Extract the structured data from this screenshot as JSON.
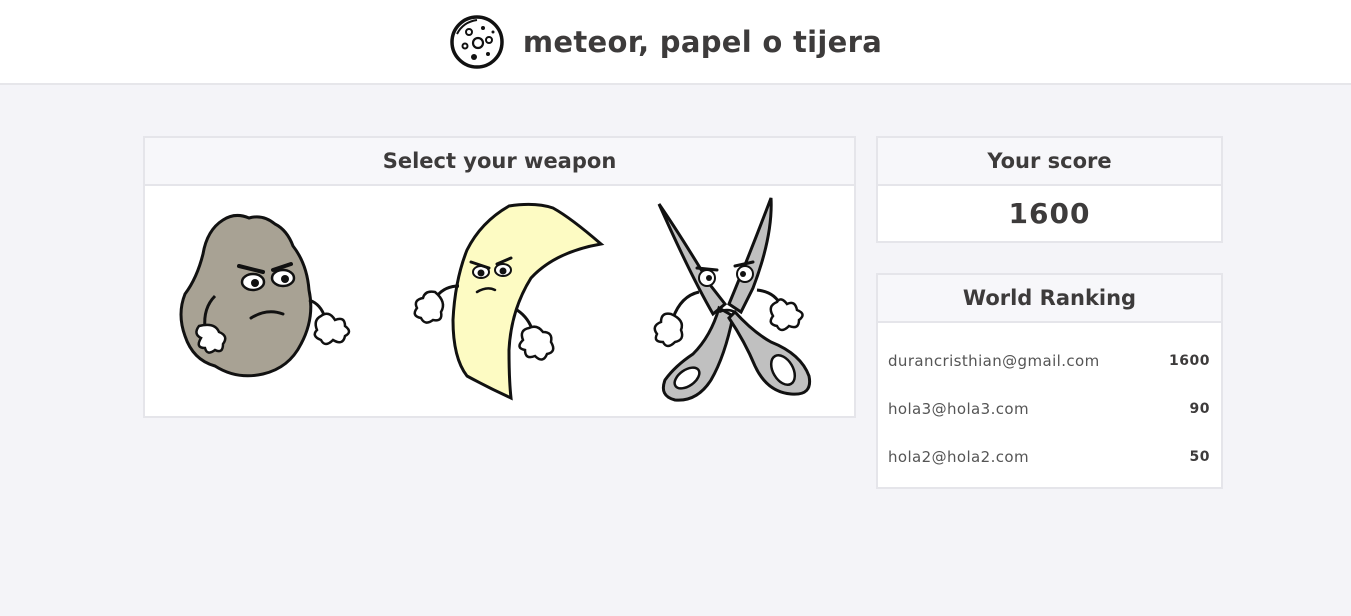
{
  "header": {
    "title": "meteor, papel o tijera",
    "logo_icon": "meteor-icon"
  },
  "weapons": {
    "title": "Select your weapon",
    "items": [
      {
        "name": "rock",
        "icon": "rock-character-icon",
        "color": "#a8a294"
      },
      {
        "name": "paper",
        "icon": "paper-character-icon",
        "color": "#fdfbc3"
      },
      {
        "name": "scissors",
        "icon": "scissors-character-icon",
        "color": "#c0c0c0"
      }
    ]
  },
  "score": {
    "title": "Your score",
    "value": "1600"
  },
  "ranking": {
    "title": "World Ranking",
    "rows": [
      {
        "email": "durancristhian@gmail.com",
        "score": "1600"
      },
      {
        "email": "hola3@hola3.com",
        "score": "90"
      },
      {
        "email": "hola2@hola2.com",
        "score": "50"
      }
    ]
  },
  "colors": {
    "background": "#f4f4f8",
    "text": "#3d3b3b",
    "panel_border": "#e5e5ea"
  }
}
